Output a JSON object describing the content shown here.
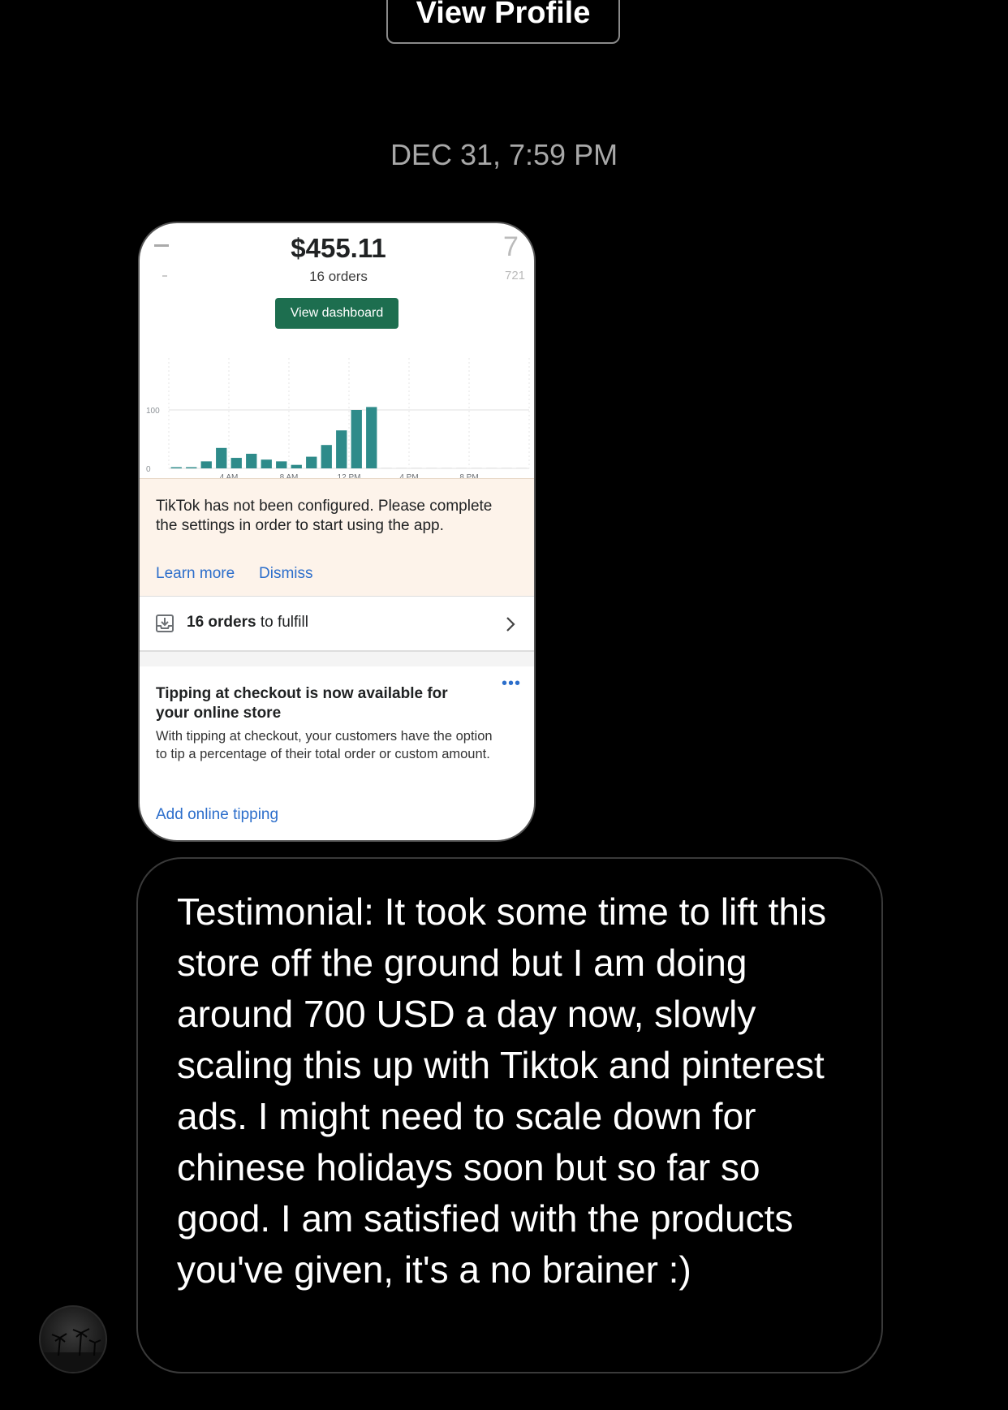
{
  "header": {
    "view_profile_label": "View Profile"
  },
  "timestamp": "DEC 31, 7:59 PM",
  "shared_image": {
    "amount": "$455.11",
    "orders_count": "16 orders",
    "peek_value": "7",
    "peek_small": "721",
    "view_dashboard_label": "View dashboard",
    "banner": {
      "text": "TikTok has not been configured. Please complete the settings in order to start using the app.",
      "learn_more": "Learn more",
      "dismiss": "Dismiss"
    },
    "fulfill": {
      "bold": "16 orders",
      "rest": " to fulfill"
    },
    "tipping": {
      "title": "Tipping at checkout is now available for your online store",
      "body": "With tipping at checkout, your customers have the option to tip a percentage of their total order or custom amount.",
      "link": "Add online tipping",
      "more": "•••"
    }
  },
  "chart_data": {
    "type": "bar",
    "y_ticks": [
      "100",
      "0"
    ],
    "ylim": [
      0,
      100
    ],
    "x_tick_labels": [
      "4 AM",
      "8 AM",
      "12 PM",
      "4 PM",
      "8 PM"
    ],
    "hours": [
      0,
      1,
      2,
      3,
      4,
      5,
      6,
      7,
      8,
      9,
      10,
      11,
      12,
      13,
      14,
      15,
      16,
      17,
      18,
      19,
      20,
      21,
      22,
      23
    ],
    "values": [
      2,
      2,
      12,
      35,
      18,
      25,
      15,
      12,
      6,
      20,
      40,
      65,
      100,
      105,
      0,
      0,
      0,
      0,
      0,
      0,
      0,
      0,
      0,
      0
    ],
    "bar_color": "#2e8b8a"
  },
  "message": {
    "text": "Testimonial: It took some time to lift this store off the ground but I am doing around 700 USD a day now, slowly scaling this up with Tiktok and pinterest ads. I might need to scale down for chinese holidays soon but so far so good. I am satisfied with the products you've given, it's a no brainer :)"
  }
}
